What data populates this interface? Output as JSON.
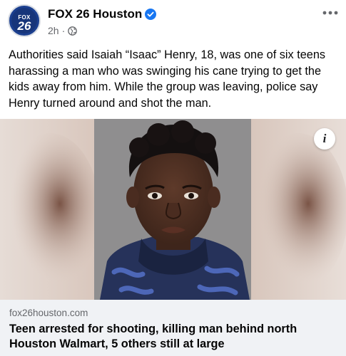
{
  "post": {
    "page_name": "FOX 26 Houston",
    "avatar": {
      "brand": "FOX",
      "number": "26"
    },
    "time": "2h",
    "separator": "·",
    "audience_icon": "globe-icon",
    "verified_icon": "verified-badge-icon",
    "more_icon": "more-horizontal-icon",
    "caption": "Authorities said Isaiah “Isaac” Henry, 18, was one of six teens harassing a man who was swinging his cane trying to get the kids away from him. While the group was leaving, police say Henry turned around and shot the man.",
    "info_label": "i",
    "link": {
      "domain": "fox26houston.com",
      "headline": "Teen arrested for shooting, killing man behind north Houston Walmart, 5 others still at large"
    }
  },
  "colors": {
    "brand_blue": "#1b3f8f",
    "verified_blue": "#1877f2",
    "link_box_bg": "#f0f2f5",
    "secondary_text": "#65676b"
  }
}
